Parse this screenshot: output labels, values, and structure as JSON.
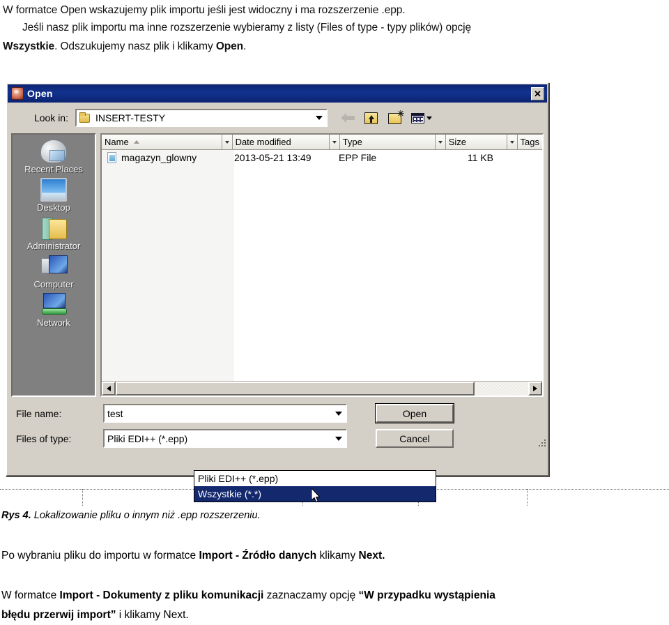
{
  "document": {
    "paragraph1": "W formatce Open wskazujemy plik importu jeśli jest widoczny i ma rozszerzenie .epp.",
    "paragraph2": "Jeśli nasz plik importu ma inne rozszerzenie wybieramy z listy (Files of type - typy plików) opcję",
    "paragraph3_pre": "Wszystkie",
    "paragraph3_mid": ". Odszukujemy nasz plik i klikamy ",
    "paragraph3_bold": "Open",
    "paragraph3_end": ".",
    "caption_label": "Rys 4.",
    "caption_text": " Lokalizowanie pliku o innym niż .epp rozszerzeniu.",
    "paragraph4_a": "Po wybraniu pliku do importu w formatce  ",
    "paragraph4_b": "Import - Źródło danych",
    "paragraph4_c": " klikamy ",
    "paragraph4_d": "Next.",
    "paragraph5_a": "W formatce ",
    "paragraph5_b": "Import - Dokumenty z pliku komunikacji",
    "paragraph5_c": " zaznaczamy opcję ",
    "paragraph5_d": "“W przypadku wystąpienia",
    "paragraph6_a": "błędu przerwij import”",
    "paragraph6_b": " i klikamy Next."
  },
  "dialog": {
    "title": "Open",
    "close_label": "✕",
    "lookin": {
      "label": "Look in:",
      "value": "INSERT-TESTY",
      "icon": "folder-icon",
      "dropdown_icon": "chevron-down-icon"
    },
    "toolbar": [
      {
        "name": "back-button",
        "icon": "back-arrow-icon"
      },
      {
        "name": "up-one-level-button",
        "icon": "up-folder-icon"
      },
      {
        "name": "new-folder-button",
        "icon": "new-folder-icon"
      },
      {
        "name": "views-button",
        "icon": "views-grid-icon"
      }
    ],
    "places": [
      {
        "label": "Recent Places",
        "icon": "recent-places-icon"
      },
      {
        "label": "Desktop",
        "icon": "desktop-icon"
      },
      {
        "label": "Administrator",
        "icon": "user-folder-icon"
      },
      {
        "label": "Computer",
        "icon": "computer-icon"
      },
      {
        "label": "Network",
        "icon": "network-icon"
      }
    ],
    "columns": [
      {
        "label": "Name",
        "sorted": "asc"
      },
      {
        "label": "Date modified",
        "sorted": ""
      },
      {
        "label": "Type",
        "sorted": ""
      },
      {
        "label": "Size",
        "sorted": ""
      },
      {
        "label": "Tags",
        "sorted": ""
      }
    ],
    "files": [
      {
        "name": "magazyn_glowny",
        "date_modified": "2013-05-21 13:49",
        "type": "EPP File",
        "size": "11 KB",
        "tags": "",
        "icon": "epp-file-icon"
      }
    ],
    "file_name": {
      "label": "File name:",
      "value": "test",
      "placeholder": ""
    },
    "files_of_type": {
      "label": "Files of type:",
      "value": "Pliki EDI++ (*.epp)",
      "options": [
        {
          "label": "Pliki EDI++ (*.epp)",
          "selected": false
        },
        {
          "label": "Wszystkie (*.*)",
          "selected": true
        }
      ]
    },
    "buttons": {
      "open": "Open",
      "cancel": "Cancel"
    }
  },
  "colors": {
    "titlebar": "#12328f",
    "dialog_face": "#d4d0c8",
    "places_bar": "#808080",
    "selection": "#14286e",
    "folder_yellow": "#e8c355"
  }
}
